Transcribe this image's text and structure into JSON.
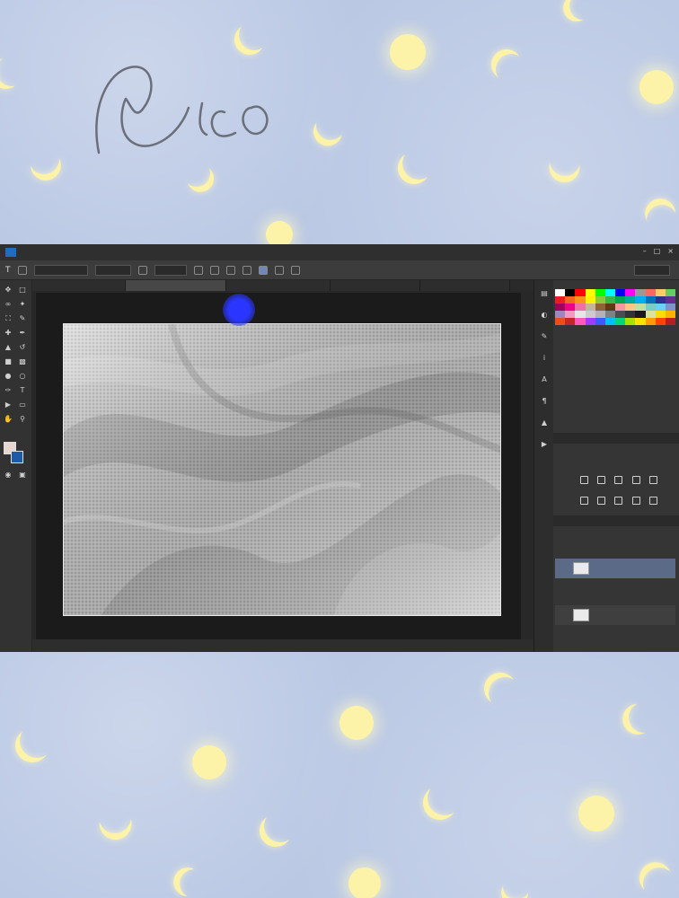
{
  "photoshop": {
    "menus": [
      "",
      "",
      "",
      "",
      "",
      "",
      "",
      "",
      "",
      "",
      ""
    ],
    "doc_tabs": [
      {
        "label": "",
        "active": false
      },
      {
        "label": "",
        "active": true
      },
      {
        "label": "",
        "active": false
      },
      {
        "label": "",
        "active": false
      },
      {
        "label": "",
        "active": false
      }
    ],
    "status_zoom": "",
    "status_info": "",
    "layers": [
      {
        "name": "",
        "selected": true
      },
      {
        "name": "",
        "selected": false
      }
    ]
  },
  "colors": {
    "background": "#bac8e4",
    "moon": "#fdf3a8",
    "cursor": "#2a36ff",
    "foreground_swatch": "#e8d6d0",
    "background_swatch": "#1d5aa8"
  },
  "icons": {
    "signature": "handwritten-signature",
    "cursor": "blue-dot-cursor"
  }
}
